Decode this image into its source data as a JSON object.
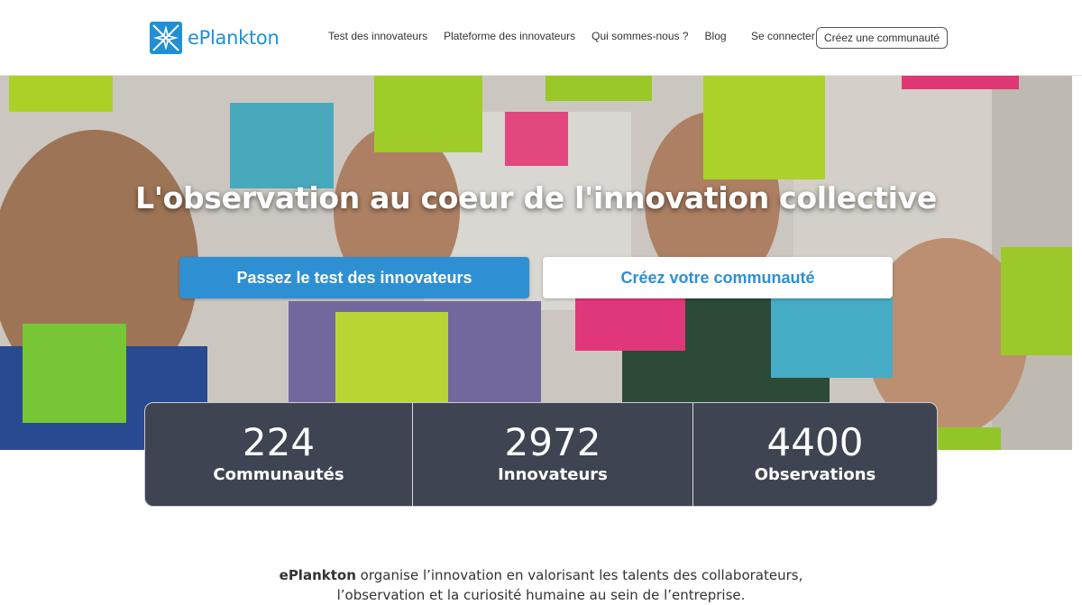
{
  "brand": {
    "name": "ePlankton",
    "color": "#1f8fd6"
  },
  "nav": {
    "items": [
      {
        "label": "Test des innovateurs"
      },
      {
        "label": "Plateforme des innovateurs"
      },
      {
        "label": "Qui sommes-nous ?"
      },
      {
        "label": "Blog"
      }
    ],
    "login_label": "Se connecter",
    "create_label": "Créez une communauté"
  },
  "hero": {
    "title": "L'observation au coeur de l'innovation collective",
    "primary_cta": "Passez le test des innovateurs",
    "secondary_cta": "Créez votre communauté",
    "accent_color": "#2f8fd3",
    "image": "team-with-sticky-notes-photo"
  },
  "stats": [
    {
      "value": "224",
      "label": "Communautés"
    },
    {
      "value": "2972",
      "label": "Innovateurs"
    },
    {
      "value": "4400",
      "label": "Observations"
    }
  ],
  "intro": {
    "brand_strong": "ePlankton",
    "line1_rest": " organise l’innovation en valorisant les talents des collaborateurs,",
    "line2": "l’observation et la curiosité humaine au sein de l’entreprise."
  }
}
